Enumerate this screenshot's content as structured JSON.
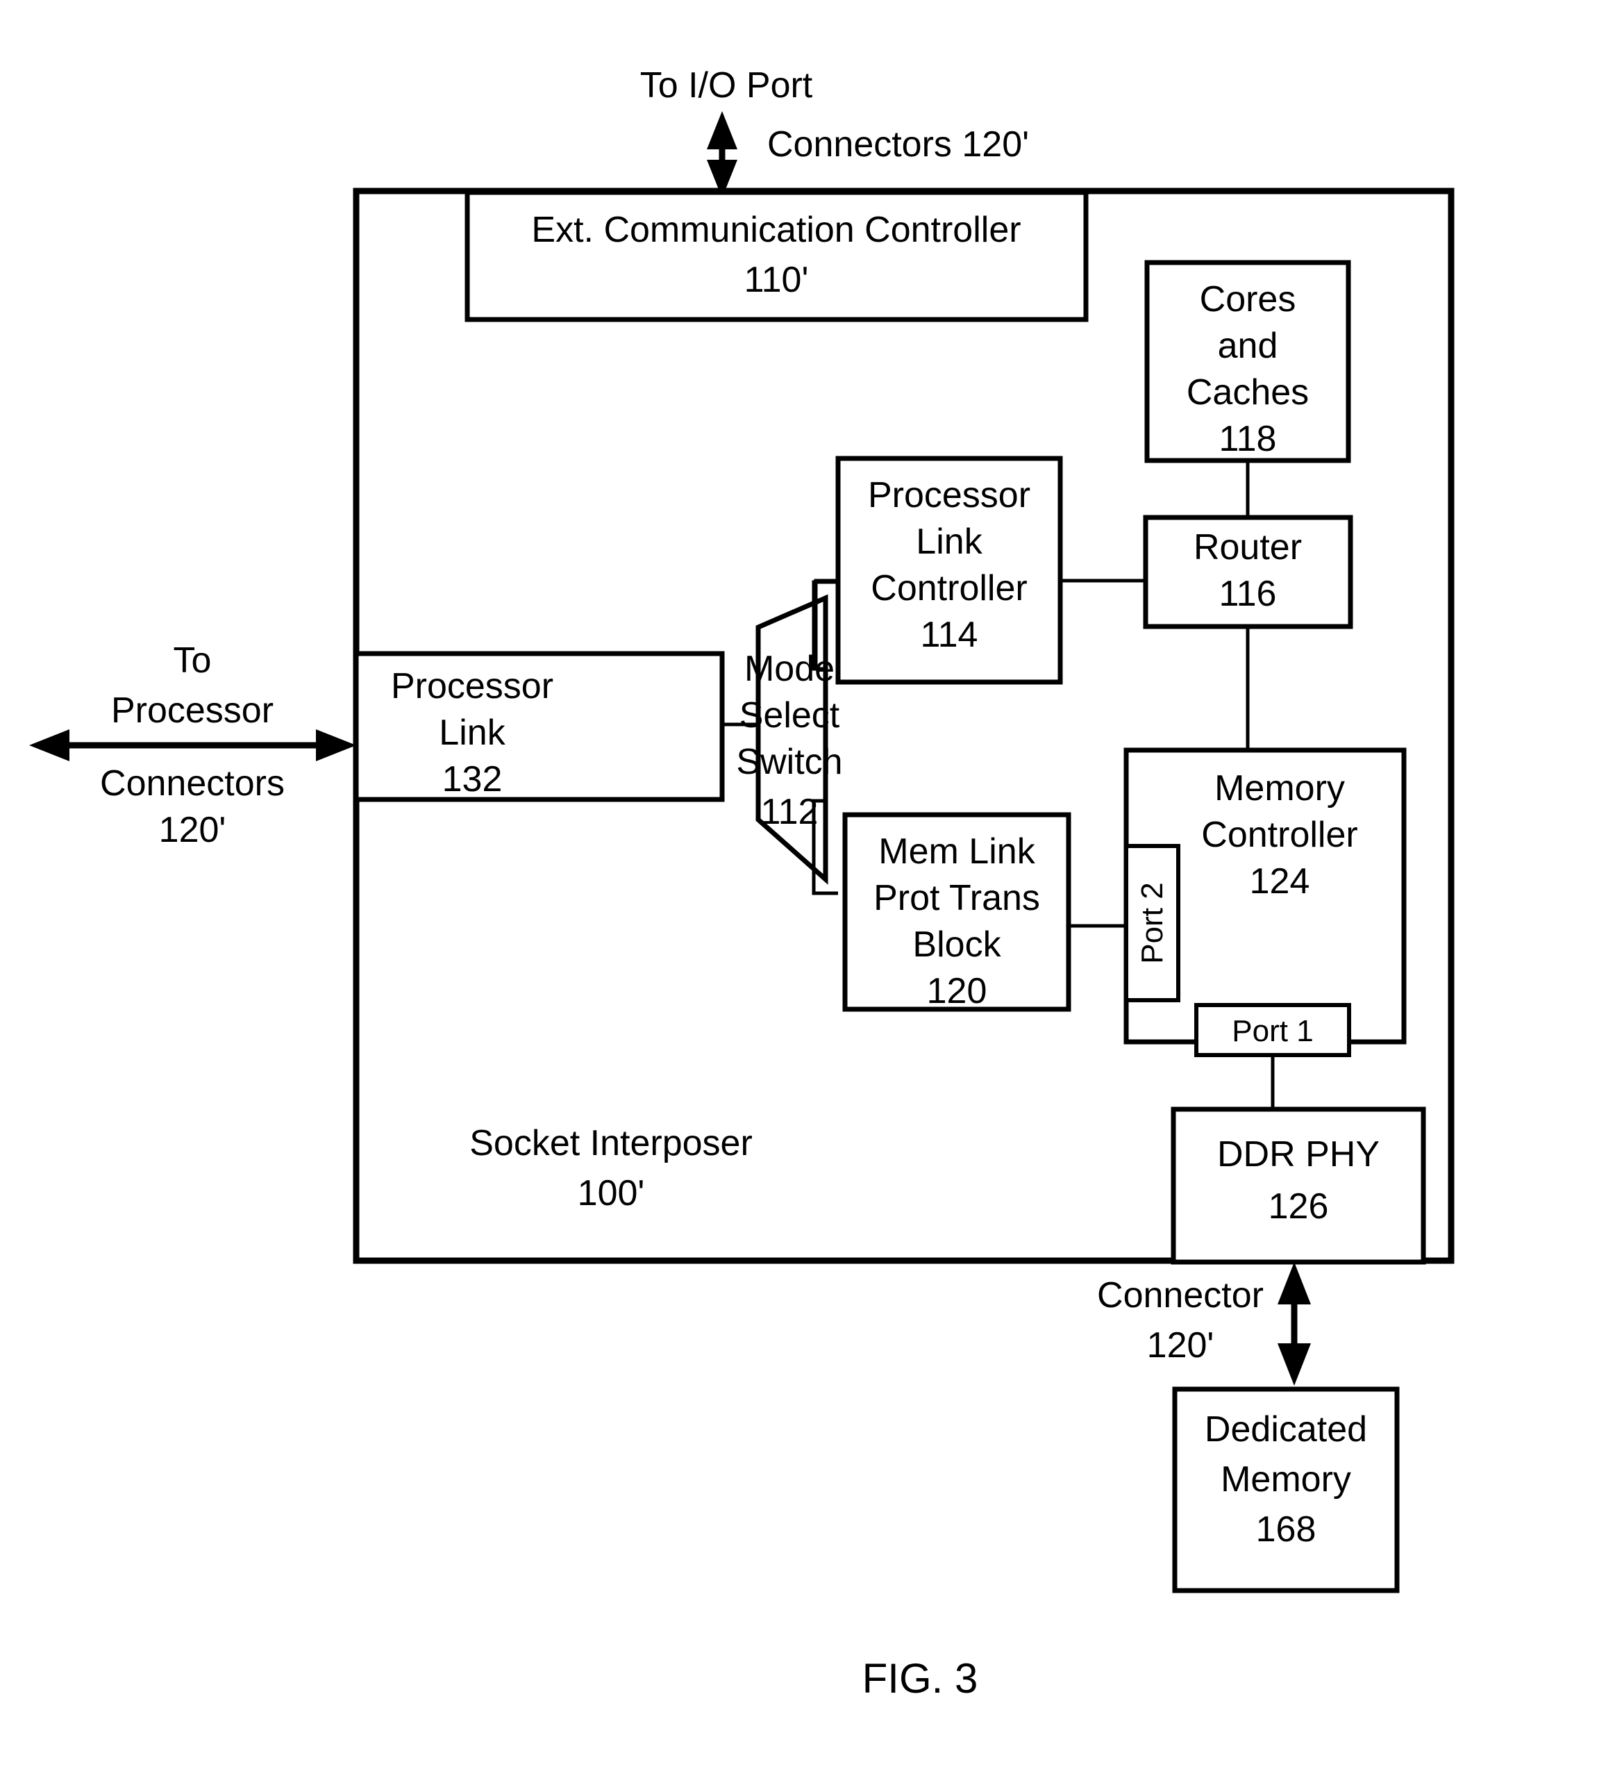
{
  "figure": {
    "caption": "FIG. 3"
  },
  "external_labels": {
    "io_port_top_line1": "To I/O Port",
    "io_port_top_line2": "Connectors 120'",
    "processor_left_line1": "To",
    "processor_left_line2": "Processor",
    "processor_left_line3": "Connectors",
    "processor_left_line4": "120'",
    "memory_connector_line1": "Connector",
    "memory_connector_line2": "120'"
  },
  "container": {
    "name_line1": "Socket Interposer",
    "name_line2": "100'"
  },
  "blocks": {
    "ext_comm_controller": {
      "line1": "Ext. Communication Controller",
      "line2": "110'"
    },
    "cores_and_caches": {
      "line1": "Cores",
      "line2": "and",
      "line3": "Caches",
      "line4": "118"
    },
    "processor_link_controller": {
      "line1": "Processor",
      "line2": "Link",
      "line3": "Controller",
      "line4": "114"
    },
    "router": {
      "line1": "Router",
      "line2": "116"
    },
    "mode_select_switch": {
      "line1": "Mode",
      "line2": "Select",
      "line3": "Switch",
      "line4": "112"
    },
    "processor_link": {
      "line1": "Processor",
      "line2": "Link",
      "line3": "132"
    },
    "mem_link_prot_trans_block": {
      "line1": "Mem Link",
      "line2": "Prot Trans",
      "line3": "Block",
      "line4": "120"
    },
    "memory_controller": {
      "line1": "Memory",
      "line2": "Controller",
      "line3": "124",
      "port2": "Port 2",
      "port1": "Port 1"
    },
    "ddr_phy": {
      "line1": "DDR PHY",
      "line2": "126"
    },
    "dedicated_memory": {
      "line1": "Dedicated",
      "line2": "Memory",
      "line3": "168"
    }
  },
  "colors": {
    "stroke": "#000000",
    "fill": "#ffffff"
  }
}
